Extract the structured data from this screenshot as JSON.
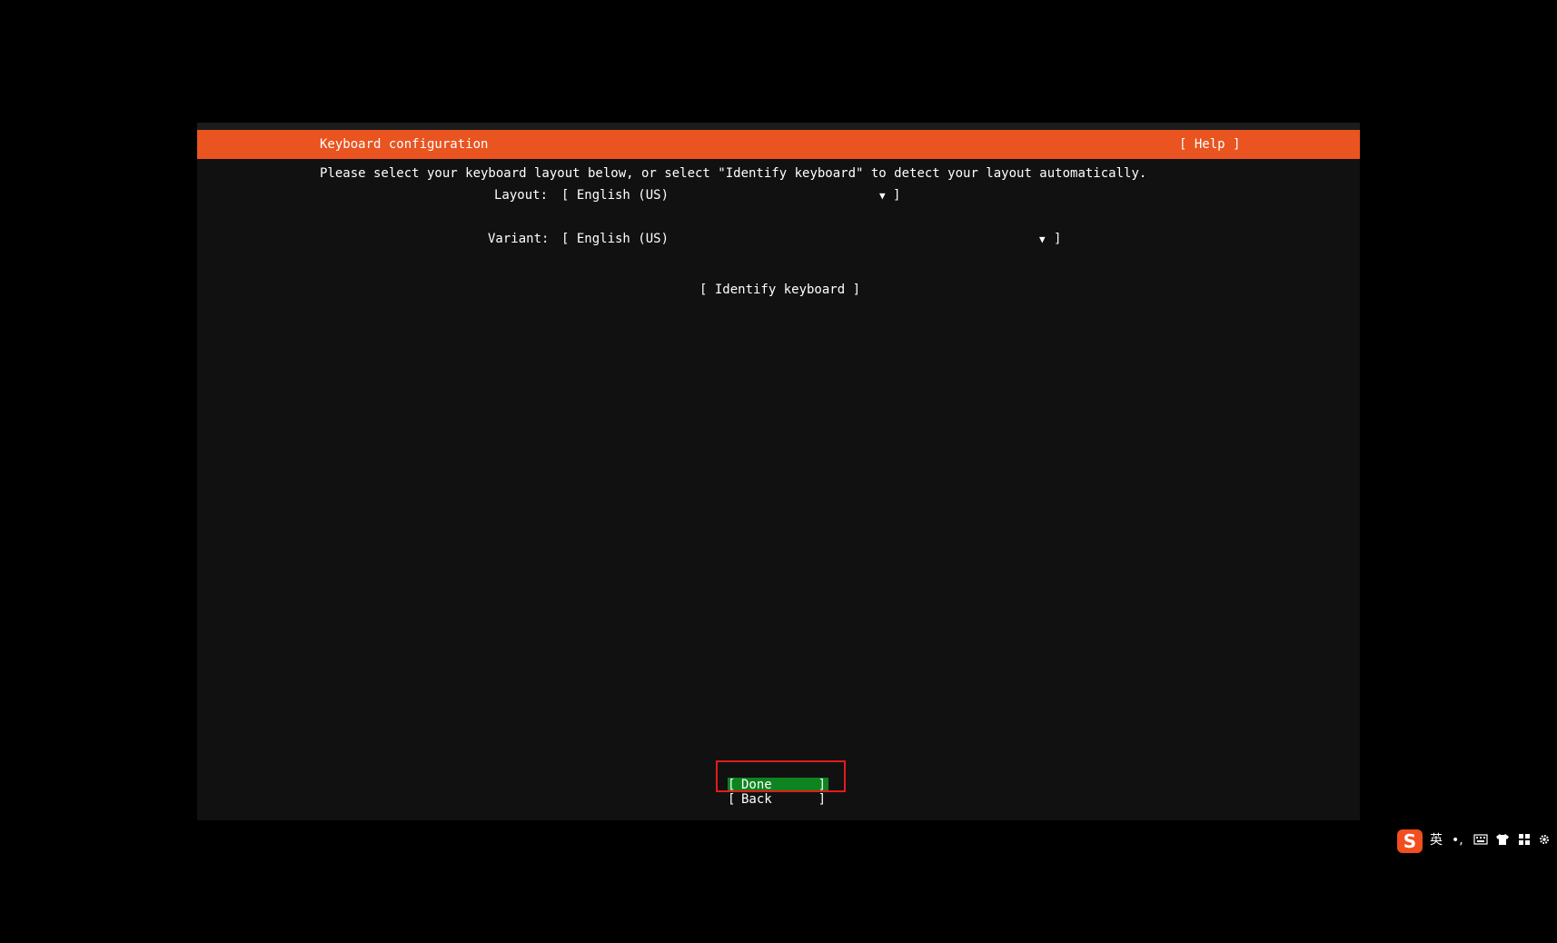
{
  "header": {
    "title": "Keyboard configuration",
    "help_label": "[ Help ]"
  },
  "instruction": "Please select your keyboard layout below, or select \"Identify keyboard\" to detect your layout automatically.",
  "layout": {
    "label": "Layout:",
    "value": "[ English (US)",
    "caret": "▼",
    "close": "]"
  },
  "variant": {
    "label": "Variant:",
    "value": "[ English (US)",
    "caret": "▼",
    "close": "]"
  },
  "identify_label": "[ Identify keyboard ]",
  "buttons": {
    "done": {
      "open": "[",
      "label": "Done",
      "close": "]"
    },
    "back": {
      "open": "[",
      "label": "Back",
      "close": "]"
    }
  },
  "colors": {
    "header": "#e95420",
    "background": "#111111",
    "focused_button": "#0e8420",
    "annotation_box": "#e31b1b"
  },
  "ime": {
    "logo": "S",
    "language": "英",
    "punctuation": "•,",
    "keyboard_icon": "keyboard-icon",
    "skin_icon": "shirt-icon",
    "toolbox_icon": "grid-icon",
    "settings_icon": "gear-icon"
  }
}
